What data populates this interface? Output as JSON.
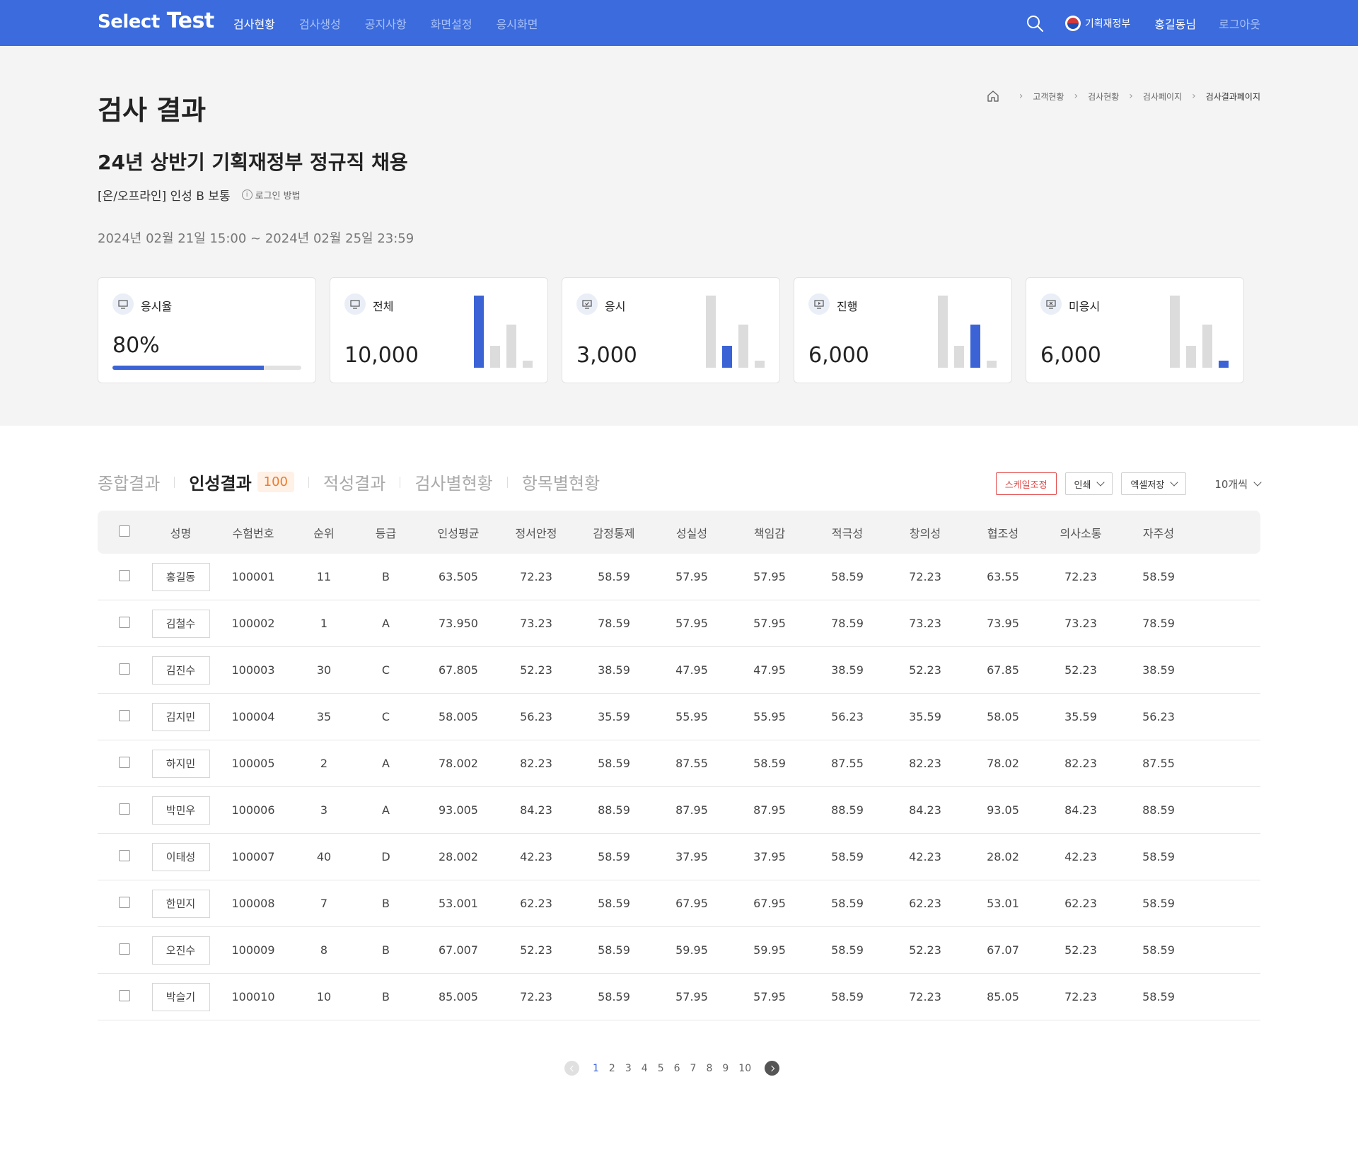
{
  "header": {
    "logo": [
      "Select",
      " Test"
    ],
    "nav": [
      {
        "label": "검사현황",
        "active": true
      },
      {
        "label": "검사생성",
        "active": false
      },
      {
        "label": "공지사항",
        "active": false
      },
      {
        "label": "화면설정",
        "active": false
      },
      {
        "label": "응시화면",
        "active": false
      }
    ],
    "org": "기획재정부",
    "user": "홍길동님",
    "logout": "로그아웃"
  },
  "summary": {
    "page_title": "검사 결과",
    "breadcrumb": [
      "고객현황",
      "검사현황",
      "검사페이지",
      "검사결과페이지"
    ],
    "exam_title": "24년 상반기 기획재정부 정규직 채용",
    "exam_sub": "[온/오프라인] 인성 B 보통",
    "login_help": "로그인 방법",
    "exam_period": "2024년 02월 21일 15:00 ~ 2024년 02월 25일 23:59",
    "cards": [
      {
        "label": "응시율",
        "value": "80%",
        "progress": 0.8,
        "icon": "monitor-icon"
      },
      {
        "label": "전체",
        "value": "10,000",
        "icon": "monitor-icon",
        "highlight": 0
      },
      {
        "label": "응시",
        "value": "3,000",
        "icon": "monitor-check-icon",
        "highlight": 1
      },
      {
        "label": "진행",
        "value": "6,000",
        "icon": "monitor-play-icon",
        "highlight": 2
      },
      {
        "label": "미응시",
        "value": "6,000",
        "icon": "monitor-x-icon",
        "highlight": 3
      }
    ],
    "mini_bar_levels": [
      1.0,
      0.3,
      0.6,
      0.1
    ],
    "colors": {
      "accent": "#3b63d6",
      "header": "#3b6bdc",
      "bar_muted": "#dcdcdc"
    }
  },
  "tabs": {
    "items": [
      {
        "label": "종합결과",
        "active": false
      },
      {
        "label": "인성결과",
        "active": true,
        "badge": "100"
      },
      {
        "label": "적성결과",
        "active": false
      },
      {
        "label": "검사별현황",
        "active": false
      },
      {
        "label": "항목별현황",
        "active": false
      }
    ],
    "scale_button": "스케일조정",
    "print_button": "인쇄",
    "excel_button": "엑셀저장",
    "per_page": "10개씩"
  },
  "table": {
    "columns": [
      "성명",
      "수험번호",
      "순위",
      "등급",
      "인성평균",
      "정서안정",
      "감정통제",
      "성실성",
      "책임감",
      "적극성",
      "창의성",
      "협조성",
      "의사소통",
      "자주성"
    ],
    "rows": [
      [
        "홍길동",
        "100001",
        "11",
        "B",
        "63.505",
        "72.23",
        "58.59",
        "57.95",
        "57.95",
        "58.59",
        "72.23",
        "63.55",
        "72.23",
        "58.59"
      ],
      [
        "김철수",
        "100002",
        "1",
        "A",
        "73.950",
        "73.23",
        "78.59",
        "57.95",
        "57.95",
        "78.59",
        "73.23",
        "73.95",
        "73.23",
        "78.59"
      ],
      [
        "김진수",
        "100003",
        "30",
        "C",
        "67.805",
        "52.23",
        "38.59",
        "47.95",
        "47.95",
        "38.59",
        "52.23",
        "67.85",
        "52.23",
        "38.59"
      ],
      [
        "김지민",
        "100004",
        "35",
        "C",
        "58.005",
        "56.23",
        "35.59",
        "55.95",
        "55.95",
        "56.23",
        "35.59",
        "58.05",
        "35.59",
        "56.23"
      ],
      [
        "하지민",
        "100005",
        "2",
        "A",
        "78.002",
        "82.23",
        "58.59",
        "87.55",
        "58.59",
        "87.55",
        "82.23",
        "78.02",
        "82.23",
        "87.55"
      ],
      [
        "박민우",
        "100006",
        "3",
        "A",
        "93.005",
        "84.23",
        "88.59",
        "87.95",
        "87.95",
        "88.59",
        "84.23",
        "93.05",
        "84.23",
        "88.59"
      ],
      [
        "이태성",
        "100007",
        "40",
        "D",
        "28.002",
        "42.23",
        "58.59",
        "37.95",
        "37.95",
        "58.59",
        "42.23",
        "28.02",
        "42.23",
        "58.59"
      ],
      [
        "한민지",
        "100008",
        "7",
        "B",
        "53.001",
        "62.23",
        "58.59",
        "67.95",
        "67.95",
        "58.59",
        "62.23",
        "53.01",
        "62.23",
        "58.59"
      ],
      [
        "오진수",
        "100009",
        "8",
        "B",
        "67.007",
        "52.23",
        "58.59",
        "59.95",
        "59.95",
        "58.59",
        "52.23",
        "67.07",
        "52.23",
        "58.59"
      ],
      [
        "박슬기",
        "100010",
        "10",
        "B",
        "85.005",
        "72.23",
        "58.59",
        "57.95",
        "57.95",
        "58.59",
        "72.23",
        "85.05",
        "72.23",
        "58.59"
      ]
    ]
  },
  "pagination": {
    "pages": [
      "1",
      "2",
      "3",
      "4",
      "5",
      "6",
      "7",
      "8",
      "9",
      "10"
    ],
    "current": "1"
  }
}
